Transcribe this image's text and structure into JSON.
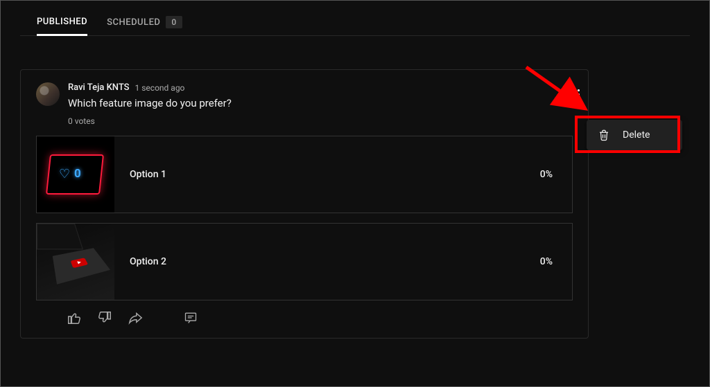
{
  "tabs": {
    "published_label": "PUBLISHED",
    "scheduled_label": "SCHEDULED",
    "scheduled_count": "0"
  },
  "post": {
    "author": "Ravi Teja KNTS",
    "time": "1 second ago",
    "text": "Which feature image do you prefer?",
    "votes": "0 votes",
    "options": [
      {
        "label": "Option 1",
        "pct": "0%"
      },
      {
        "label": "Option 2",
        "pct": "0%"
      }
    ]
  },
  "menu": {
    "delete_label": "Delete"
  }
}
